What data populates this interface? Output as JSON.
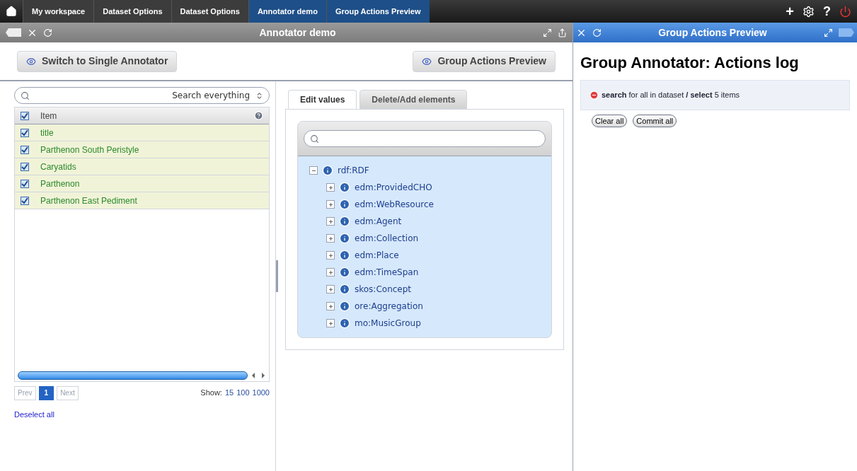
{
  "breadcrumbs": [
    {
      "label": "My workspace",
      "selected": false
    },
    {
      "label": "Dataset Options",
      "selected": false
    },
    {
      "label": "Dataset Options",
      "selected": false
    },
    {
      "label": "Annotator demo",
      "selected": true
    },
    {
      "label": "Group Actions Preview",
      "selected": true
    }
  ],
  "top_icons": [
    "+",
    "?"
  ],
  "annotator": {
    "title": "Annotator demo",
    "switch_button": "Switch to Single Annotator",
    "preview_button": "Group Actions Preview",
    "search": {
      "value": "Search everything"
    },
    "table": {
      "header_checked": true,
      "column": "Item",
      "rows": [
        {
          "label": "title",
          "checked": true
        },
        {
          "label": "Parthenon South Peristyle",
          "checked": true
        },
        {
          "label": "Caryatids",
          "checked": true
        },
        {
          "label": "Parthenon",
          "checked": true
        },
        {
          "label": "Parthenon East Pediment",
          "checked": true
        }
      ]
    },
    "pager": {
      "prev": "Prev",
      "pages": [
        {
          "label": "1",
          "selected": true
        }
      ],
      "next": "Next",
      "show_label": "Show:",
      "sizes": [
        "15",
        "100",
        "1000"
      ]
    },
    "deselect": "Deselect all",
    "tabs": [
      {
        "label": "Edit values",
        "selected": true
      },
      {
        "label": "Delete/Add elements",
        "selected": false
      }
    ],
    "tree": [
      {
        "label": "rdf:RDF",
        "expanded": true,
        "children": [
          {
            "label": "edm:ProvidedCHO",
            "expanded": false
          },
          {
            "label": "edm:WebResource",
            "expanded": false
          },
          {
            "label": "edm:Agent",
            "expanded": false
          },
          {
            "label": "edm:Collection",
            "expanded": false
          },
          {
            "label": "edm:Place",
            "expanded": false
          },
          {
            "label": "edm:TimeSpan",
            "expanded": false
          },
          {
            "label": "skos:Concept",
            "expanded": false
          },
          {
            "label": "ore:Aggregation",
            "expanded": false
          },
          {
            "label": "mo:MusicGroup",
            "expanded": false
          }
        ]
      }
    ]
  },
  "preview": {
    "title": "Group Actions Preview",
    "heading": "Group Annotator: Actions log",
    "log": "**search** for all in dataset **/ select** 5 items",
    "buttons": [
      "Clear all",
      "Commit all"
    ]
  }
}
